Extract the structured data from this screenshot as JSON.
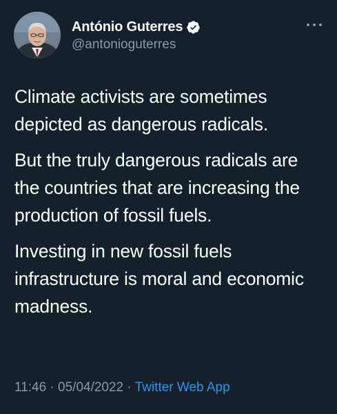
{
  "author": {
    "display_name": "António Guterres",
    "handle": "@antonioguterres",
    "verified": true
  },
  "tweet": {
    "paragraphs": [
      "Climate activists are sometimes depicted as dangerous radicals.",
      "But the truly dangerous radicals are the countries that are increasing the production of fossil fuels.",
      "Investing in new fossil fuels infrastructure is moral and economic madness."
    ],
    "time": "11:46",
    "separator": "·",
    "date": "05/04/2022",
    "source": "Twitter Web App"
  },
  "icons": {
    "verified": "verified-badge-icon",
    "more": "more-options-icon"
  },
  "colors": {
    "background": "#15202b",
    "text": "#ffffff",
    "secondary": "#8b98a5",
    "accent": "#1d9bf0"
  }
}
